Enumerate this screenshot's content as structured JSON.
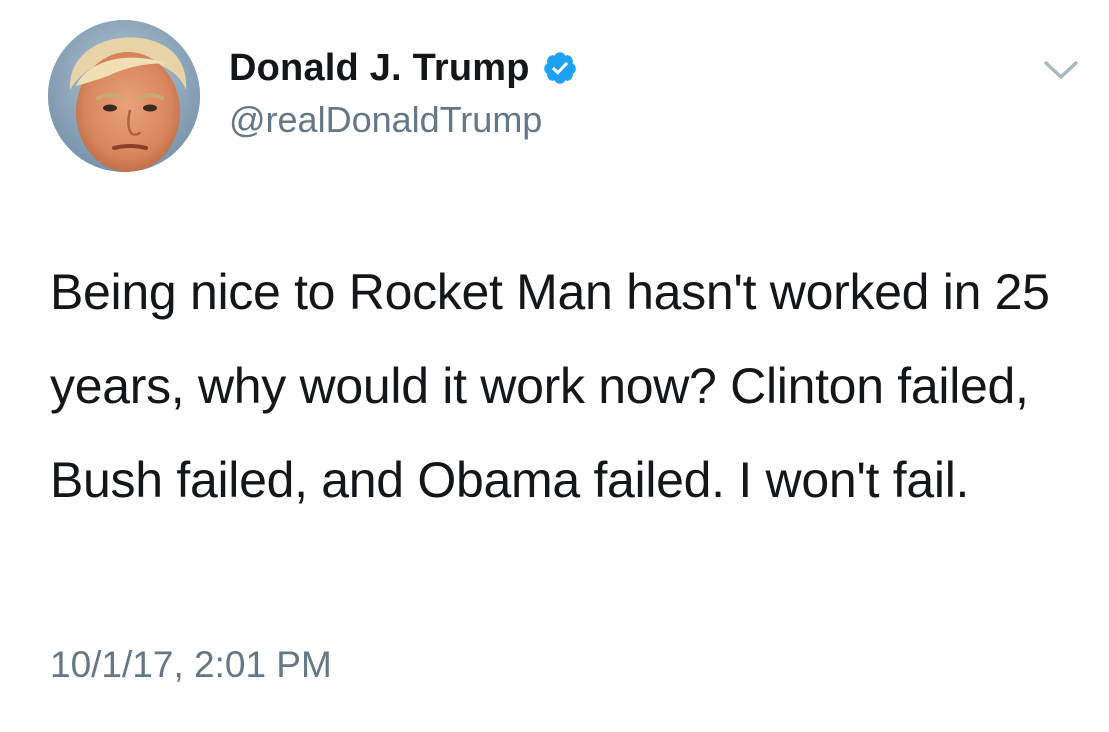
{
  "tweet": {
    "author": {
      "display_name": "Donald J. Trump",
      "handle": "@realDonaldTrump",
      "verified": true,
      "avatar": "profile-photo"
    },
    "text": "Being nice to Rocket Man hasn't worked in 25 years, why would it work now? Clinton failed, Bush failed, and Obama failed. I won't fail.",
    "timestamp": "10/1/17, 2:01 PM"
  },
  "icons": {
    "verified": "verified-badge-icon",
    "menu": "chevron-down-icon"
  },
  "colors": {
    "text_primary": "#14171a",
    "text_secondary": "#657786",
    "verified_blue": "#1da1f2",
    "chevron": "#aab8c2",
    "background": "#ffffff"
  }
}
